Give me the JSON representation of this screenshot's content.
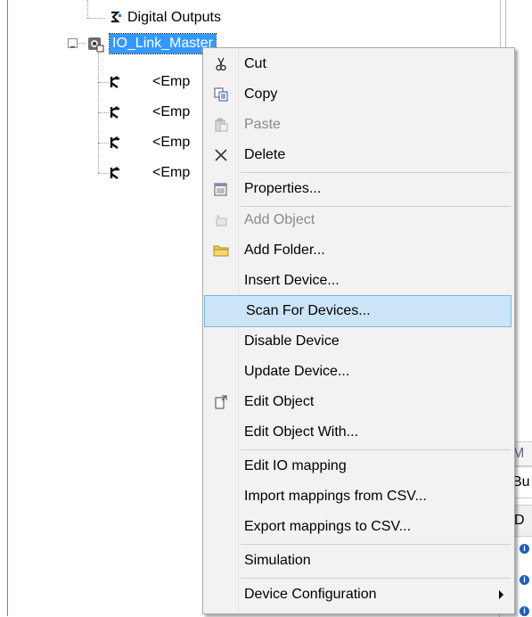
{
  "tree": {
    "digital_outputs": "Digital Outputs",
    "io_link_master": "IO_Link_Master",
    "empty_slot_label": "<Emp",
    "empty_slots": [
      "<Emp",
      "<Emp",
      "<Emp",
      "<Emp"
    ]
  },
  "context_menu": {
    "items": [
      {
        "label": "Cut",
        "icon": "scissors-icon"
      },
      {
        "label": "Copy",
        "icon": "copy-icon"
      },
      {
        "label": "Paste",
        "icon": "paste-icon",
        "disabled": true
      },
      {
        "label": "Delete",
        "icon": "delete-x-icon"
      },
      {
        "label": "Properties...",
        "icon": "properties-icon"
      },
      {
        "label": "Add Object",
        "icon": "add-object-icon",
        "disabled": true
      },
      {
        "label": "Add Folder...",
        "icon": "folder-icon"
      },
      {
        "label": "Insert Device..."
      },
      {
        "label": "Scan For Devices...",
        "highlighted": true
      },
      {
        "label": "Disable Device"
      },
      {
        "label": "Update Device..."
      },
      {
        "label": "Edit Object",
        "icon": "edit-object-icon"
      },
      {
        "label": "Edit Object With..."
      },
      {
        "label": "Edit IO mapping"
      },
      {
        "label": "Import mappings from CSV..."
      },
      {
        "label": "Export mappings to CSV..."
      },
      {
        "label": "Simulation"
      },
      {
        "label": "Device Configuration",
        "submenu": true
      }
    ]
  },
  "right_panel": {
    "header_fragment_1": "M",
    "header_fragment_2": "Bu",
    "header_fragment_3": "D"
  },
  "colors": {
    "highlight_bg": "#cce4f7",
    "highlight_border": "#7fb4e0",
    "selection_bg": "#3399ff",
    "menu_bg": "#f2f2f2"
  }
}
